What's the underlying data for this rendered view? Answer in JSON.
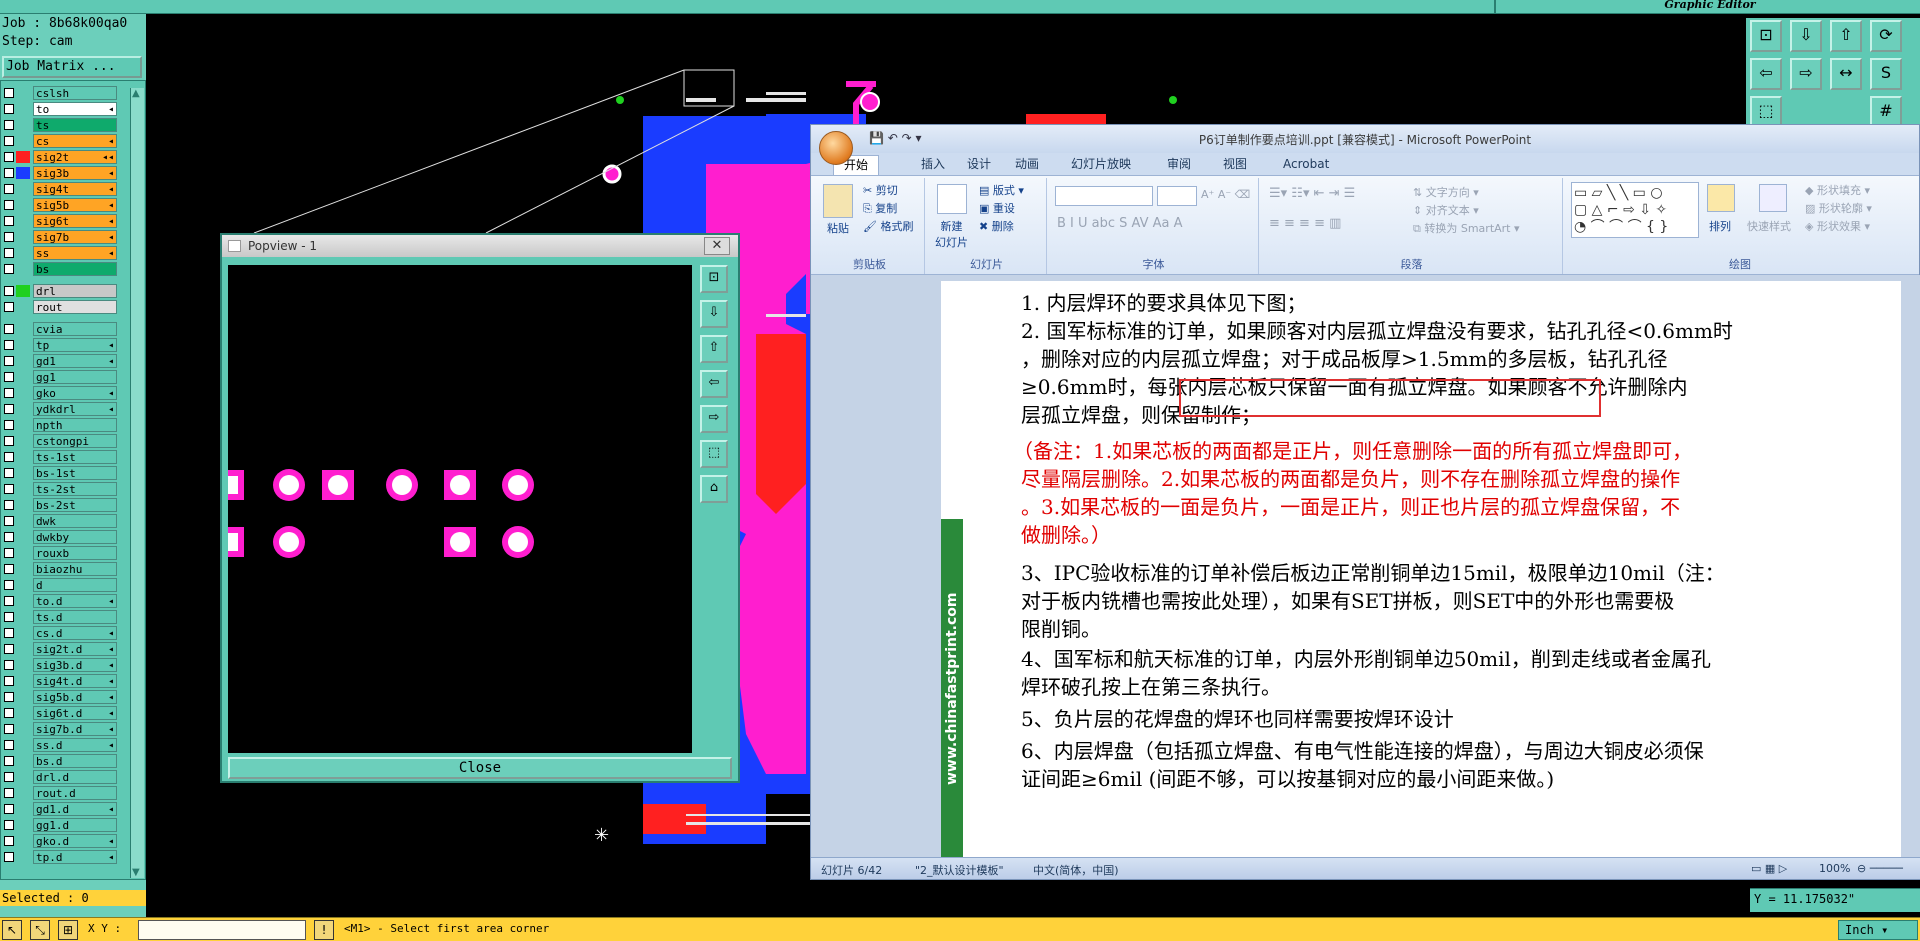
{
  "cam": {
    "top_right_title": "Graphic Editor",
    "job_label": "Job : 8b68k00qa0",
    "step_label": "Step: cam",
    "job_matrix_label": "Job Matrix ...",
    "layers_group1": [
      {
        "name": "cslsh",
        "color": "#5fc9b4",
        "flag": "",
        "swatch": ""
      },
      {
        "name": "to",
        "color": "#ffffff",
        "flag": "◂",
        "swatch": ""
      },
      {
        "name": "ts",
        "color": "#0faa6c",
        "flag": "",
        "swatch": ""
      },
      {
        "name": "cs",
        "color": "#ffa424",
        "flag": "◂",
        "swatch": ""
      },
      {
        "name": "sig2t",
        "color": "#ffa424",
        "flag": "◂◂",
        "swatch": "#ff2020"
      },
      {
        "name": "sig3b",
        "color": "#ffa424",
        "flag": "◂",
        "swatch": "#1a3cff"
      },
      {
        "name": "sig4t",
        "color": "#ffa424",
        "flag": "◂",
        "swatch": ""
      },
      {
        "name": "sig5b",
        "color": "#ffa424",
        "flag": "◂",
        "swatch": ""
      },
      {
        "name": "sig6t",
        "color": "#ffa424",
        "flag": "◂",
        "swatch": ""
      },
      {
        "name": "sig7b",
        "color": "#ffa424",
        "flag": "◂",
        "swatch": ""
      },
      {
        "name": "ss",
        "color": "#ffa424",
        "flag": "◂",
        "swatch": ""
      },
      {
        "name": "bs",
        "color": "#0faa6c",
        "flag": "",
        "swatch": ""
      }
    ],
    "layers_group2": [
      {
        "name": "drl",
        "color": "#c8c8c8",
        "flag": "",
        "swatch": "#20d020"
      },
      {
        "name": "rout",
        "color": "#e0e0e0",
        "flag": "",
        "swatch": ""
      }
    ],
    "layers_group3": [
      {
        "name": "cvia",
        "color": "#5fc9b4",
        "flag": "",
        "swatch": ""
      },
      {
        "name": "tp",
        "color": "#5fc9b4",
        "flag": "◂",
        "swatch": ""
      },
      {
        "name": "gd1",
        "color": "#5fc9b4",
        "flag": "◂",
        "swatch": ""
      },
      {
        "name": "gg1",
        "color": "#5fc9b4",
        "flag": "",
        "swatch": ""
      },
      {
        "name": "gko",
        "color": "#5fc9b4",
        "flag": "◂",
        "swatch": ""
      },
      {
        "name": "ydkdrl",
        "color": "#5fc9b4",
        "flag": "◂",
        "swatch": ""
      },
      {
        "name": "npth",
        "color": "#5fc9b4",
        "flag": "",
        "swatch": ""
      },
      {
        "name": "cstongpi",
        "color": "#5fc9b4",
        "flag": "",
        "swatch": ""
      },
      {
        "name": "ts-1st",
        "color": "#5fc9b4",
        "flag": "",
        "swatch": ""
      },
      {
        "name": "bs-1st",
        "color": "#5fc9b4",
        "flag": "",
        "swatch": ""
      },
      {
        "name": "ts-2st",
        "color": "#5fc9b4",
        "flag": "",
        "swatch": ""
      },
      {
        "name": "bs-2st",
        "color": "#5fc9b4",
        "flag": "",
        "swatch": ""
      },
      {
        "name": "dwk",
        "color": "#5fc9b4",
        "flag": "",
        "swatch": ""
      },
      {
        "name": "dwkby",
        "color": "#5fc9b4",
        "flag": "",
        "swatch": ""
      },
      {
        "name": "rouxb",
        "color": "#5fc9b4",
        "flag": "",
        "swatch": ""
      },
      {
        "name": "biaozhu",
        "color": "#5fc9b4",
        "flag": "",
        "swatch": ""
      },
      {
        "name": "d",
        "color": "#5fc9b4",
        "flag": "",
        "swatch": ""
      },
      {
        "name": "to.d",
        "color": "#5fc9b4",
        "flag": "◂",
        "swatch": ""
      },
      {
        "name": "ts.d",
        "color": "#5fc9b4",
        "flag": "",
        "swatch": ""
      },
      {
        "name": "cs.d",
        "color": "#5fc9b4",
        "flag": "◂",
        "swatch": ""
      },
      {
        "name": "sig2t.d",
        "color": "#5fc9b4",
        "flag": "◂",
        "swatch": ""
      },
      {
        "name": "sig3b.d",
        "color": "#5fc9b4",
        "flag": "◂",
        "swatch": ""
      },
      {
        "name": "sig4t.d",
        "color": "#5fc9b4",
        "flag": "◂",
        "swatch": ""
      },
      {
        "name": "sig5b.d",
        "color": "#5fc9b4",
        "flag": "◂",
        "swatch": ""
      },
      {
        "name": "sig6t.d",
        "color": "#5fc9b4",
        "flag": "◂",
        "swatch": ""
      },
      {
        "name": "sig7b.d",
        "color": "#5fc9b4",
        "flag": "◂",
        "swatch": ""
      },
      {
        "name": "ss.d",
        "color": "#5fc9b4",
        "flag": "◂",
        "swatch": ""
      },
      {
        "name": "bs.d",
        "color": "#5fc9b4",
        "flag": "",
        "swatch": ""
      },
      {
        "name": "drl.d",
        "color": "#5fc9b4",
        "flag": "",
        "swatch": ""
      },
      {
        "name": "rout.d",
        "color": "#5fc9b4",
        "flag": "",
        "swatch": ""
      },
      {
        "name": "gd1.d",
        "color": "#5fc9b4",
        "flag": "◂",
        "swatch": ""
      },
      {
        "name": "gg1.d",
        "color": "#5fc9b4",
        "flag": "",
        "swatch": ""
      },
      {
        "name": "gko.d",
        "color": "#5fc9b4",
        "flag": "◂",
        "swatch": ""
      },
      {
        "name": "tp.d",
        "color": "#5fc9b4",
        "flag": "◂",
        "swatch": ""
      }
    ],
    "selected_label": "Selected : 0",
    "xy_label": "X Y :",
    "status_message": "<M1> - Select first area corner",
    "coord_readout": "Y = 11.175032\"",
    "unit_label": "Inch",
    "colors": {
      "teal": "#5fc9b4",
      "magenta": "#ff1ecf",
      "blue": "#1a3cff",
      "red": "#ff2020",
      "status_yellow": "#ffd23a"
    }
  },
  "popview": {
    "title": "Popview - 1",
    "close_label": "Close",
    "tools": [
      "zoom-fit-icon",
      "zoom-in-icon",
      "zoom-out-icon",
      "pan-left-icon",
      "pan-right-icon",
      "zoom-window-icon",
      "zoom-home-icon"
    ]
  },
  "ppt": {
    "title": "P6订单制作要点培训.ppt [兼容模式] - Microsoft PowerPoint",
    "tabs": [
      "开始",
      "插入",
      "设计",
      "动画",
      "幻灯片放映",
      "审阅",
      "视图",
      "Acrobat"
    ],
    "ribbon": {
      "clipboard": {
        "label": "剪贴板",
        "paste": "粘贴",
        "cut": "剪切",
        "copy": "复制",
        "format_painter": "格式刷"
      },
      "slides": {
        "label": "幻灯片",
        "new_slide": "新建\n幻灯片",
        "layout": "版式",
        "reset": "重设",
        "delete": "删除"
      },
      "font": {
        "label": "字体"
      },
      "paragraph": {
        "label": "段落",
        "text_direction": "文字方向",
        "align_text": "对齐文本",
        "smartart": "转换为 SmartArt"
      },
      "drawing": {
        "label": "绘图",
        "arrange": "排列",
        "quick_styles": "快速样式",
        "shape_fill": "形状填充",
        "shape_outline": "形状轮廓",
        "shape_effects": "形状效果"
      }
    },
    "slide": {
      "side_text": "www.chinafastprint.com",
      "lines": [
        {
          "text": "1. 内层焊环的要求具体见下图；",
          "red": false
        },
        {
          "text": "2. 国军标标准的订单，如果顾客对内层孤立焊盘没有要求，钻孔孔径<0.6mm时",
          "red": false
        },
        {
          "text": "   ，删除对应的内层孤立焊盘；对于成品板厚>1.5mm的多层板，钻孔孔径",
          "red": false
        },
        {
          "text": "   ≥0.6mm时，每张内层芯板只保留一面有孤立焊盘。如果顾客不允许删除内",
          "red": false
        },
        {
          "text": "   层孤立焊盘，则保留制作；",
          "red": false
        },
        {
          "text": "（备注：1.如果芯板的两面都是正片，则任意删除一面的所有孤立焊盘即可，",
          "red": true
        },
        {
          "text": "   尽量隔层删除。2.如果芯板的两面都是负片，则不存在删除孤立焊盘的操作",
          "red": true
        },
        {
          "text": "   。3.如果芯板的一面是负片，一面是正片，则正也片层的孤立焊盘保留，不",
          "red": true
        },
        {
          "text": "   做删除。）",
          "red": true
        },
        {
          "text": "3、IPC验收标准的订单补偿后板边正常削铜单边15mil，极限单边10mil（注：",
          "red": false
        },
        {
          "text": "   对于板内铣槽也需按此处理），如果有SET拼板，则SET中的外形也需要极",
          "red": false
        },
        {
          "text": "   限削铜。",
          "red": false
        },
        {
          "text": "4、国军标和航天标准的订单，内层外形削铜单边50mil，削到走线或者金属孔",
          "red": false
        },
        {
          "text": "   焊环破孔按上在第三条执行。",
          "red": false
        },
        {
          "text": "5、负片层的花焊盘的焊环也同样需要按焊环设计",
          "red": false
        },
        {
          "text": "6、内层焊盘（包括孤立焊盘、有电气性能连接的焊盘），与周边大铜皮必须保",
          "red": false
        },
        {
          "text": "   证间距≥6mil (间距不够，可以按基铜对应的最小间距来做。)",
          "red": false
        }
      ]
    },
    "status": {
      "slide_no": "幻灯片 6/42",
      "theme": "\"2_默认设计模板\"",
      "lang": "中文(简体，中国)",
      "zoom": "100%"
    }
  }
}
